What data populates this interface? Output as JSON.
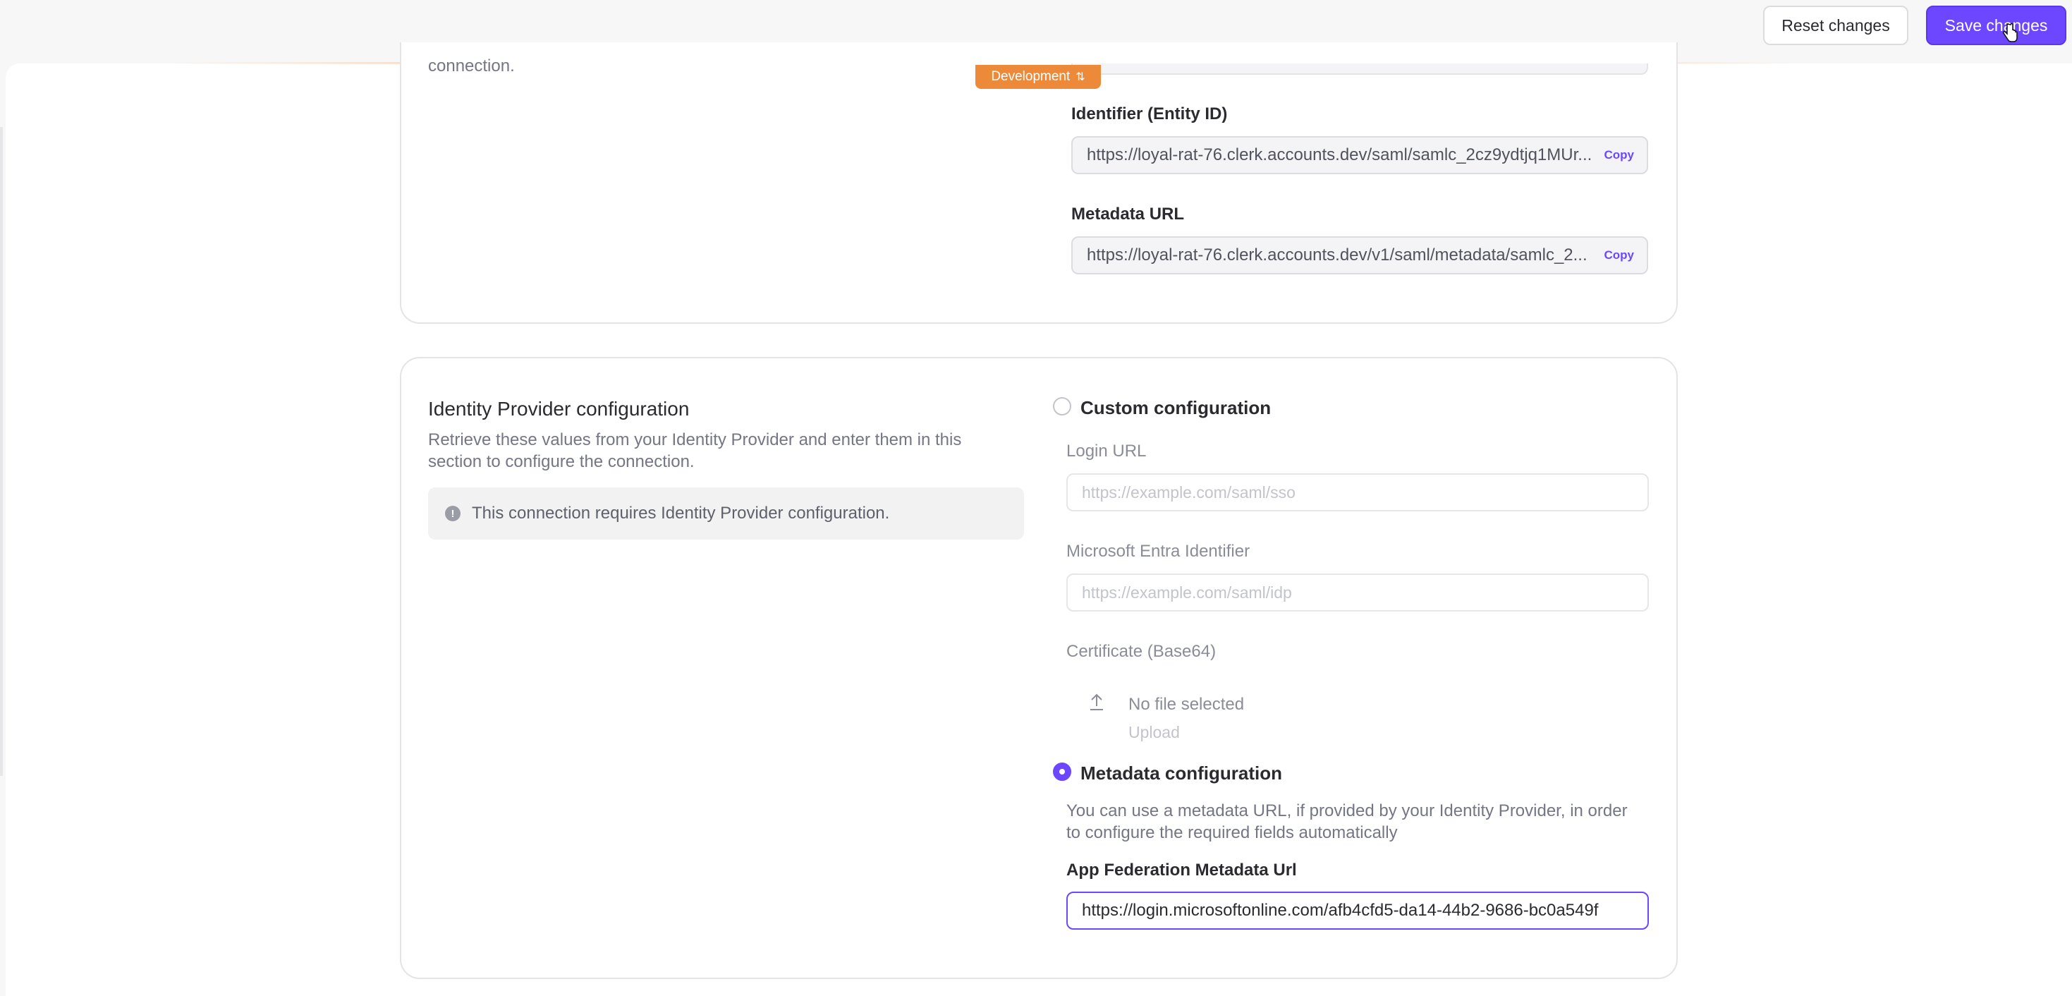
{
  "toolbar": {
    "reset_label": "Reset changes",
    "save_label": "Save changes"
  },
  "environment_badge": "Development",
  "sp_section": {
    "connection_text": "connection.",
    "entity_id": {
      "label": "Identifier (Entity ID)",
      "value": "https://loyal-rat-76.clerk.accounts.dev/saml/samlc_2cz9ydtjq1MUr...",
      "copy_label": "Copy"
    },
    "metadata_url": {
      "label": "Metadata URL",
      "value": "https://loyal-rat-76.clerk.accounts.dev/v1/saml/metadata/samlc_2...",
      "copy_label": "Copy"
    }
  },
  "idp_section": {
    "title": "Identity Provider configuration",
    "description": "Retrieve these values from your Identity Provider and enter them in this section to configure the connection.",
    "info": "This connection requires Identity Provider configuration.",
    "custom": {
      "label": "Custom configuration",
      "selected": false,
      "login_url_label": "Login URL",
      "login_url_placeholder": "https://example.com/saml/sso",
      "entra_label": "Microsoft Entra Identifier",
      "entra_placeholder": "https://example.com/saml/idp",
      "certificate_label": "Certificate (Base64)",
      "no_file": "No file selected",
      "upload": "Upload"
    },
    "metadata": {
      "label": "Metadata configuration",
      "selected": true,
      "description": "You can use a metadata URL, if provided by your Identity Provider, in order to configure the required fields automatically",
      "field_label": "App Federation Metadata Url",
      "field_value": "https://login.microsoftonline.com/afb4cfd5-da14-44b2-9686-bc0a549f"
    }
  },
  "colors": {
    "accent": "#6c47ff",
    "badge": "#ec8a3a"
  }
}
